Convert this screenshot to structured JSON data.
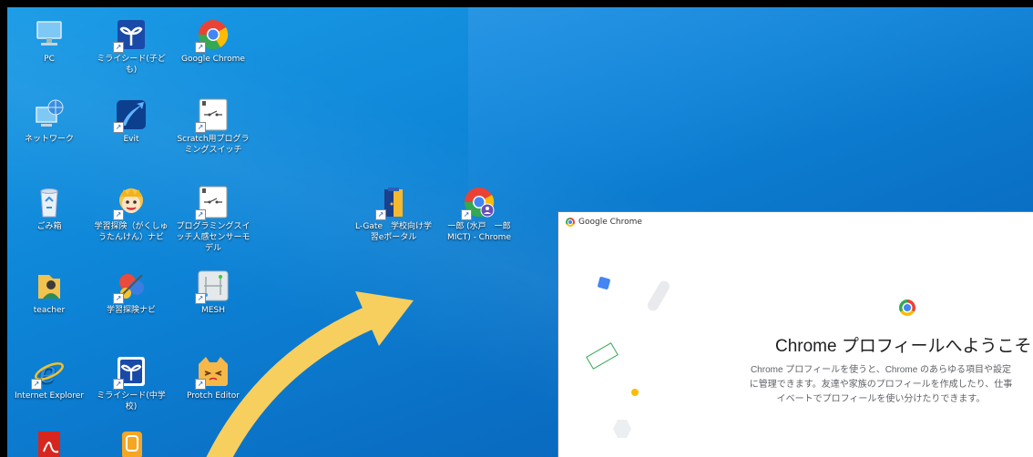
{
  "desktop": {
    "icons": [
      {
        "label": "PC",
        "icon": "pc-icon"
      },
      {
        "label": "ミライシード(子ども)",
        "icon": "miraiseed-icon"
      },
      {
        "label": "Google Chrome",
        "icon": "chrome-icon"
      },
      {
        "label": "ネットワーク",
        "icon": "network-icon"
      },
      {
        "label": "Evit",
        "icon": "evit-icon"
      },
      {
        "label": "Scratch用プログラミングスイッチ",
        "icon": "switch-icon"
      },
      {
        "label": "ごみ箱",
        "icon": "recycle-bin-icon"
      },
      {
        "label": "学習探険（がくしゅうたんけん）ナビ",
        "icon": "gakushu-navi-icon"
      },
      {
        "label": "プログラミングスイッチ人感センサーモデル",
        "icon": "switch-icon"
      },
      {
        "label": "L-Gate　学校向け学習eポータル",
        "icon": "lgate-icon"
      },
      {
        "label": "一郎 (水戸　一郎 MICT) - Chrome",
        "icon": "chrome-profile-icon"
      },
      {
        "label": "teacher",
        "icon": "user-folder-icon"
      },
      {
        "label": "学習探険ナビ",
        "icon": "gakushu-navi2-icon"
      },
      {
        "label": "MESH",
        "icon": "mesh-icon"
      },
      {
        "label": "Internet Explorer",
        "icon": "ie-icon"
      },
      {
        "label": "ミライシード(中学校)",
        "icon": "miraiseed-icon"
      },
      {
        "label": "Protch Editor",
        "icon": "protch-icon"
      },
      {
        "label": "",
        "icon": "acrobat-icon"
      },
      {
        "label": "",
        "icon": "app-icon"
      }
    ]
  },
  "chrome_window": {
    "title": "Google Chrome",
    "welcome_title": "Chrome プロフィールへようこそ",
    "desc_line1": "Chrome プロフィールを使うと、Chrome のあらゆる項目や設定",
    "desc_line2": "に管理できます。友達や家族のプロフィールを作成したり、仕事",
    "desc_line3": "イベートでプロフィールを使い分けたりできます。"
  },
  "colors": {
    "desktop": "#0d83d6",
    "arrow": "#f7cf5e",
    "chrome_blue": "#4285f4",
    "chrome_red": "#ea4335",
    "chrome_yellow": "#fbbc05",
    "chrome_green": "#34a853"
  }
}
